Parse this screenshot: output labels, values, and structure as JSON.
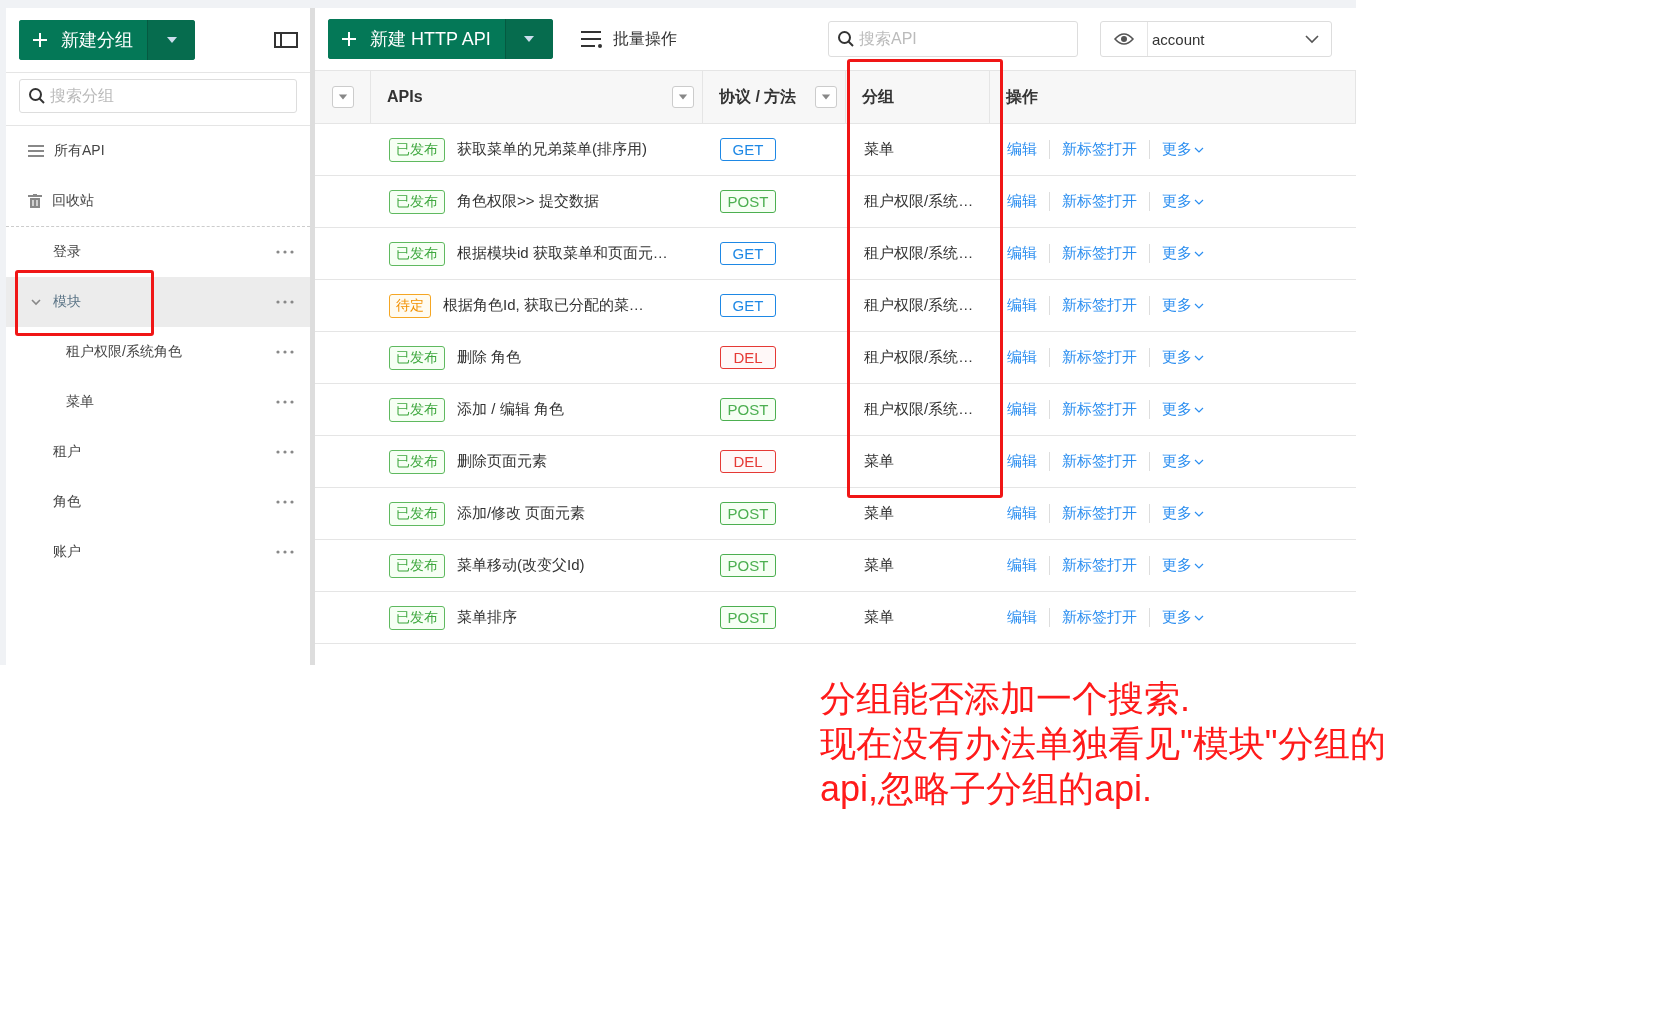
{
  "sidebar": {
    "new_button": "新建分组",
    "search": {
      "placeholder": "搜索分组"
    },
    "items": [
      {
        "label": "所有API",
        "kind": "all"
      },
      {
        "label": "回收站",
        "kind": "trash"
      }
    ],
    "groups": [
      {
        "label": "登录",
        "selected": false
      },
      {
        "label": "模块",
        "selected": true,
        "expanded": true,
        "children": [
          {
            "label": "租户权限/系统角色",
            "selected": false
          },
          {
            "label": "菜单",
            "selected": false
          }
        ]
      },
      {
        "label": "租户",
        "selected": false
      },
      {
        "label": "角色",
        "selected": false
      },
      {
        "label": "账户",
        "selected": false
      }
    ]
  },
  "toolbar": {
    "new_button": "新建 HTTP API",
    "batch_button": "批量操作",
    "search": {
      "placeholder": "搜索API"
    },
    "env_select": {
      "value": "account"
    }
  },
  "table": {
    "columns": [
      "APIs",
      "协议 / 方法",
      "分组",
      "操作"
    ],
    "rows": [
      {
        "status": {
          "label": "已发布",
          "kind": "published"
        },
        "name": "获取菜单的兄弟菜单(排序用)",
        "method": {
          "label": "GET",
          "kind": "get"
        },
        "group": "菜单",
        "actions": [
          "编辑",
          "新标签打开",
          "更多"
        ]
      },
      {
        "status": {
          "label": "已发布",
          "kind": "published"
        },
        "name": "角色权限>> 提交数据",
        "method": {
          "label": "POST",
          "kind": "post"
        },
        "group": "租户权限/系统…",
        "actions": [
          "编辑",
          "新标签打开",
          "更多"
        ]
      },
      {
        "status": {
          "label": "已发布",
          "kind": "published"
        },
        "name": "根据模块id 获取菜单和页面元…",
        "method": {
          "label": "GET",
          "kind": "get"
        },
        "group": "租户权限/系统…",
        "actions": [
          "编辑",
          "新标签打开",
          "更多"
        ]
      },
      {
        "status": {
          "label": "待定",
          "kind": "pending"
        },
        "name": "根据角色Id, 获取已分配的菜…",
        "method": {
          "label": "GET",
          "kind": "get"
        },
        "group": "租户权限/系统…",
        "actions": [
          "编辑",
          "新标签打开",
          "更多"
        ]
      },
      {
        "status": {
          "label": "已发布",
          "kind": "published"
        },
        "name": "删除 角色",
        "method": {
          "label": "DEL",
          "kind": "delete"
        },
        "group": "租户权限/系统…",
        "actions": [
          "编辑",
          "新标签打开",
          "更多"
        ]
      },
      {
        "status": {
          "label": "已发布",
          "kind": "published"
        },
        "name": "添加 / 编辑 角色",
        "method": {
          "label": "POST",
          "kind": "post"
        },
        "group": "租户权限/系统…",
        "actions": [
          "编辑",
          "新标签打开",
          "更多"
        ]
      },
      {
        "status": {
          "label": "已发布",
          "kind": "published"
        },
        "name": "删除页面元素",
        "method": {
          "label": "DEL",
          "kind": "delete"
        },
        "group": "菜单",
        "actions": [
          "编辑",
          "新标签打开",
          "更多"
        ]
      },
      {
        "status": {
          "label": "已发布",
          "kind": "published"
        },
        "name": "添加/修改 页面元素",
        "method": {
          "label": "POST",
          "kind": "post"
        },
        "group": "菜单",
        "actions": [
          "编辑",
          "新标签打开",
          "更多"
        ]
      },
      {
        "status": {
          "label": "已发布",
          "kind": "published"
        },
        "name": "菜单移动(改变父Id)",
        "method": {
          "label": "POST",
          "kind": "post"
        },
        "group": "菜单",
        "actions": [
          "编辑",
          "新标签打开",
          "更多"
        ]
      },
      {
        "status": {
          "label": "已发布",
          "kind": "published"
        },
        "name": "菜单排序",
        "method": {
          "label": "POST",
          "kind": "post"
        },
        "group": "菜单",
        "actions": [
          "编辑",
          "新标签打开",
          "更多"
        ]
      }
    ]
  },
  "annotation": {
    "lines": [
      "分组能否添加一个搜索.",
      "现在没有办法单独看见\"模块\"分组的",
      "api,忽略子分组的api."
    ]
  }
}
